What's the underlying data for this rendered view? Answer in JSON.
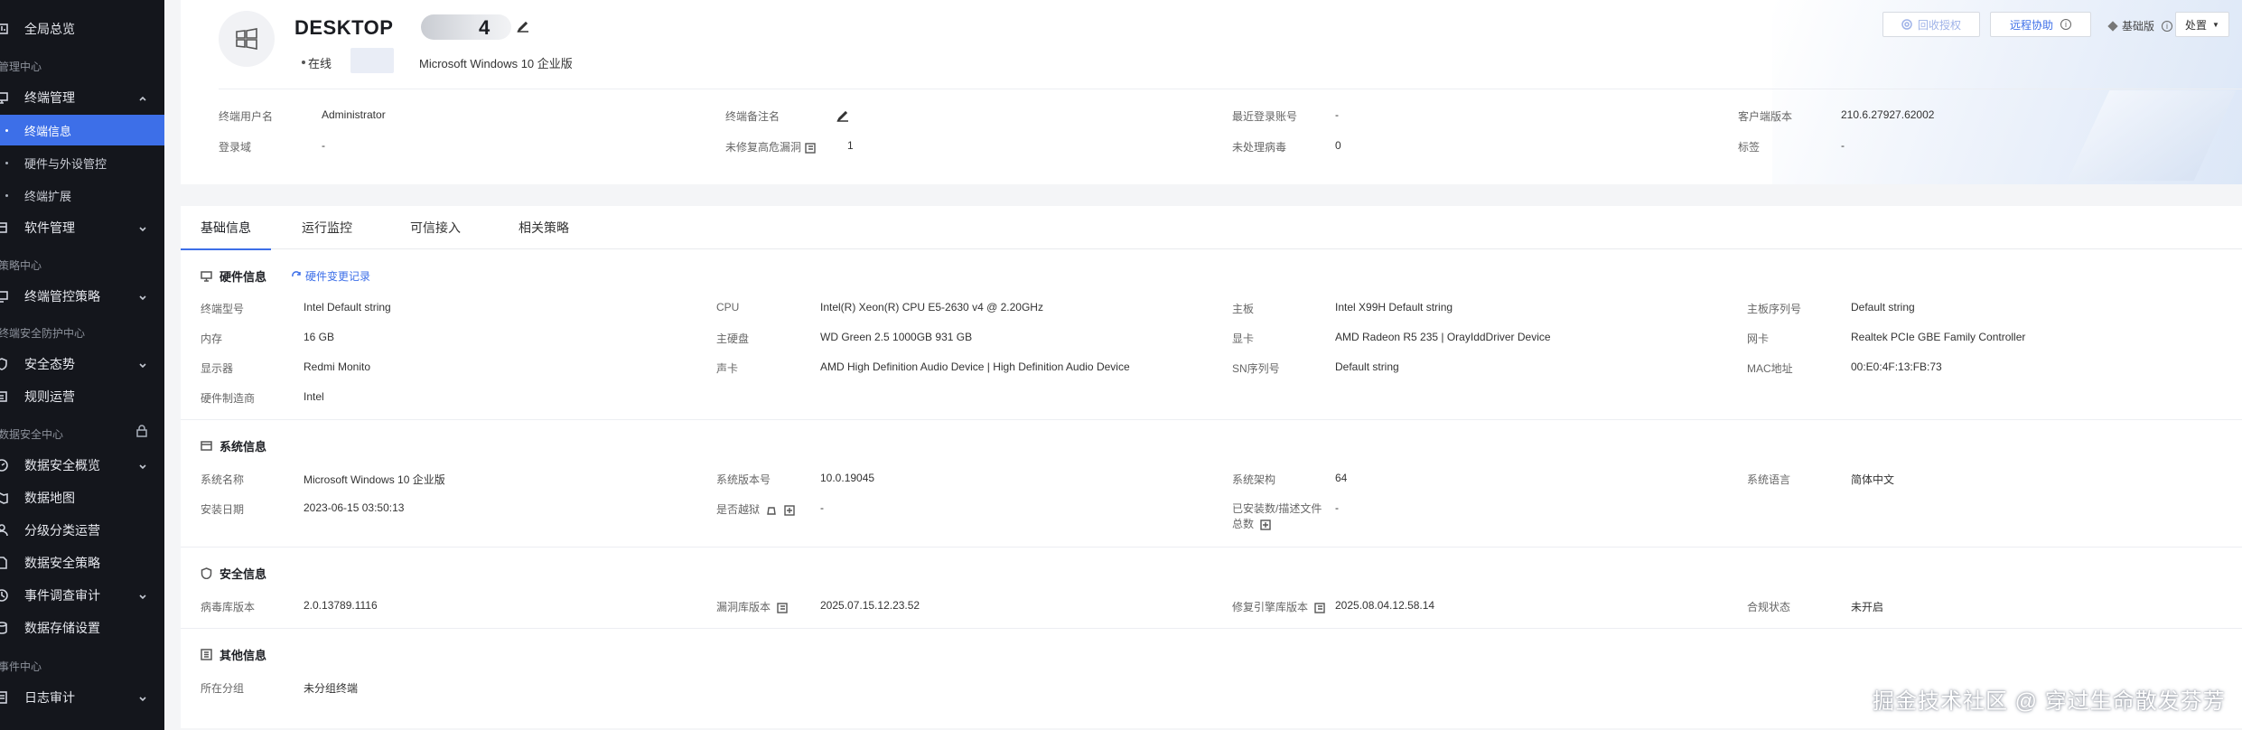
{
  "sidebar": {
    "items": [
      {
        "label": "全局总览"
      },
      {
        "label": "管理中心"
      },
      {
        "label": "终端管理"
      },
      {
        "label": "终端信息"
      },
      {
        "label": "硬件与外设管控"
      },
      {
        "label": "终端扩展"
      },
      {
        "label": "软件管理"
      },
      {
        "label": "策略中心"
      },
      {
        "label": "终端管控策略"
      },
      {
        "label": "终端安全防护中心"
      },
      {
        "label": "安全态势"
      },
      {
        "label": "规则运营"
      },
      {
        "label": "数据安全中心"
      },
      {
        "label": "数据安全概览"
      },
      {
        "label": "数据地图"
      },
      {
        "label": "分级分类运营"
      },
      {
        "label": "数据安全策略"
      },
      {
        "label": "事件调查审计"
      },
      {
        "label": "数据存储设置"
      },
      {
        "label": "事件中心"
      },
      {
        "label": "日志审计"
      }
    ]
  },
  "header": {
    "hostname": "DESKTOP",
    "hostname_tail": "4",
    "status": "在线",
    "os": "Microsoft Windows 10 企业版",
    "buttons": {
      "recall": "回收授权",
      "remote": "远程协助",
      "edition": "基础版",
      "action": "处置"
    },
    "fields": [
      {
        "label": "终端用户名",
        "value": "Administrator"
      },
      {
        "label": "终端备注名",
        "value": ""
      },
      {
        "label": "最近登录账号",
        "value": "-"
      },
      {
        "label": "客户端版本",
        "value": "210.6.27927.62002"
      },
      {
        "label": "登录域",
        "value": "-"
      },
      {
        "label": "未修复高危漏洞",
        "value": "1"
      },
      {
        "label": "未处理病毒",
        "value": "0"
      },
      {
        "label": "标签",
        "value": "-"
      }
    ]
  },
  "tabs": [
    "基础信息",
    "运行监控",
    "可信接入",
    "相关策略"
  ],
  "hardware": {
    "title": "硬件信息",
    "link": "硬件变更记录",
    "fields": [
      {
        "label": "终端型号",
        "value": "Intel Default string"
      },
      {
        "label": "CPU",
        "value": "Intel(R) Xeon(R) CPU E5-2630 v4 @ 2.20GHz"
      },
      {
        "label": "主板",
        "value": "Intel X99H Default string"
      },
      {
        "label": "主板序列号",
        "value": "Default string"
      },
      {
        "label": "内存",
        "value": "16 GB"
      },
      {
        "label": "主硬盘",
        "value": "WD Green 2.5 1000GB 931 GB"
      },
      {
        "label": "显卡",
        "value": "AMD Radeon R5 235 | OrayIddDriver Device"
      },
      {
        "label": "网卡",
        "value": "Realtek PCIe GBE Family Controller"
      },
      {
        "label": "显示器",
        "value": "Redmi Monito"
      },
      {
        "label": "声卡",
        "value": "AMD High Definition Audio Device | High Definition Audio Device"
      },
      {
        "label": "SN序列号",
        "value": "Default string"
      },
      {
        "label": "MAC地址",
        "value": "00:E0:4F:13:FB:73"
      },
      {
        "label": "硬件制造商",
        "value": "Intel"
      }
    ]
  },
  "system": {
    "title": "系统信息",
    "fields": [
      {
        "label": "系统名称",
        "value": "Microsoft Windows 10 企业版"
      },
      {
        "label": "系统版本号",
        "value": "10.0.19045"
      },
      {
        "label": "系统架构",
        "value": "64"
      },
      {
        "label": "系统语言",
        "value": "简体中文"
      },
      {
        "label": "安装日期",
        "value": "2023-06-15 03:50:13"
      },
      {
        "label": "是否越狱",
        "value": "-"
      },
      {
        "label": "已安装数/描述文件",
        "label2": "总数",
        "value": "-"
      }
    ]
  },
  "security": {
    "title": "安全信息",
    "fields": [
      {
        "label": "病毒库版本",
        "value": "2.0.13789.1116"
      },
      {
        "label": "漏洞库版本",
        "value": "2025.07.15.12.23.52"
      },
      {
        "label": "修复引擎库版本",
        "value": "2025.08.04.12.58.14"
      },
      {
        "label": "合规状态",
        "value": "未开启"
      }
    ]
  },
  "other": {
    "title": "其他信息",
    "fields": [
      {
        "label": "所在分组",
        "value": "未分组终端"
      }
    ]
  },
  "watermark": "掘金技术社区 @ 穿过生命散发芬芳",
  "colors": {
    "sidebar_bg": "#14161c",
    "accent": "#3d6fe8",
    "page_bg": "#f4f5f7"
  }
}
